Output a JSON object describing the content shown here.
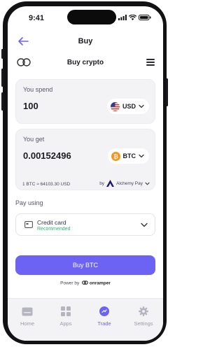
{
  "status": {
    "time": "9:41"
  },
  "nav": {
    "title": "Buy"
  },
  "header": {
    "title": "Buy crypto"
  },
  "spend": {
    "label": "You spend",
    "amount": "100",
    "currency": "USD",
    "flag": "us-flag-icon"
  },
  "get": {
    "label": "You get",
    "amount": "0.00152496",
    "currency": "BTC",
    "coin": "bitcoin-icon"
  },
  "rate": {
    "text": "1 BTC ≈ 64103.30 USD",
    "by_label": "by",
    "provider": "Alchemy Pay"
  },
  "payment": {
    "label": "Pay using",
    "method": "Credit card",
    "badge": "Recommended"
  },
  "cta": {
    "label": "Buy BTC"
  },
  "powered": {
    "prefix": "Power by",
    "brand": "onramper"
  },
  "tabs": [
    {
      "label": "Home",
      "icon": "home-icon"
    },
    {
      "label": "Apps",
      "icon": "apps-icon"
    },
    {
      "label": "Trade",
      "icon": "trade-icon",
      "active": true
    },
    {
      "label": "Settings",
      "icon": "settings-icon"
    }
  ],
  "colors": {
    "accent": "#6c63f5",
    "bitcoin": "#f7931a",
    "recommended": "#2bb673",
    "card_bg": "#f3f3f6"
  }
}
